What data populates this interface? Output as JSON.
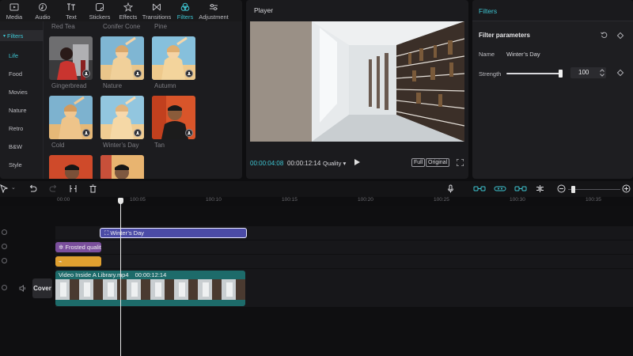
{
  "tabs": [
    {
      "label": "Media",
      "icon": "media-icon"
    },
    {
      "label": "Audio",
      "icon": "audio-icon"
    },
    {
      "label": "Text",
      "icon": "text-icon"
    },
    {
      "label": "Stickers",
      "icon": "stickers-icon"
    },
    {
      "label": "Effects",
      "icon": "effects-icon"
    },
    {
      "label": "Transitions",
      "icon": "transitions-icon"
    },
    {
      "label": "Filters",
      "icon": "filters-icon",
      "active": true
    },
    {
      "label": "Adjustment",
      "icon": "adjustment-icon"
    }
  ],
  "rail": {
    "header": "Filters",
    "items": [
      "Life",
      "Food",
      "Movies",
      "Nature",
      "Retro",
      "B&W",
      "Style"
    ],
    "active": "Life"
  },
  "filters_grid": [
    {
      "name": "Red Tea"
    },
    {
      "name": "Conifer Cone"
    },
    {
      "name": "Pine"
    },
    {
      "name": "Gingerbread"
    },
    {
      "name": "Nature"
    },
    {
      "name": "Autumn"
    },
    {
      "name": "Cold"
    },
    {
      "name": "Winter’s Day"
    },
    {
      "name": "Tan"
    }
  ],
  "player": {
    "title": "Player",
    "current_time": "00:00:04:08",
    "total_time": "00:00:12:14",
    "quality": "Quality",
    "fit_button": "Full",
    "ratio_button": "Original"
  },
  "filter_panel": {
    "title": "Filters",
    "params_title": "Filter parameters",
    "name_label": "Name",
    "name_value": "Winter’s Day",
    "strength_label": "Strength",
    "strength_value": "100",
    "strength_fraction": 1.0
  },
  "ruler": [
    "00:00",
    "100:05",
    "100:10",
    "100:15",
    "100:20",
    "100:25",
    "100:30",
    "100:35"
  ],
  "tracks": {
    "filter_clip": "Winter’s Day",
    "effect_clip": "Frosted quality",
    "video_clip_name": "Video Inside A Library.mp4",
    "video_clip_duration": "00:00:12:14",
    "cover_label": "Cover"
  },
  "colors": {
    "accent": "#3ec6d3",
    "filter_clip": "#4b4ba6",
    "effect_clip": "#7a4e9c",
    "adjust_clip": "#e0a030",
    "video_clip": "#1d6b6a"
  }
}
